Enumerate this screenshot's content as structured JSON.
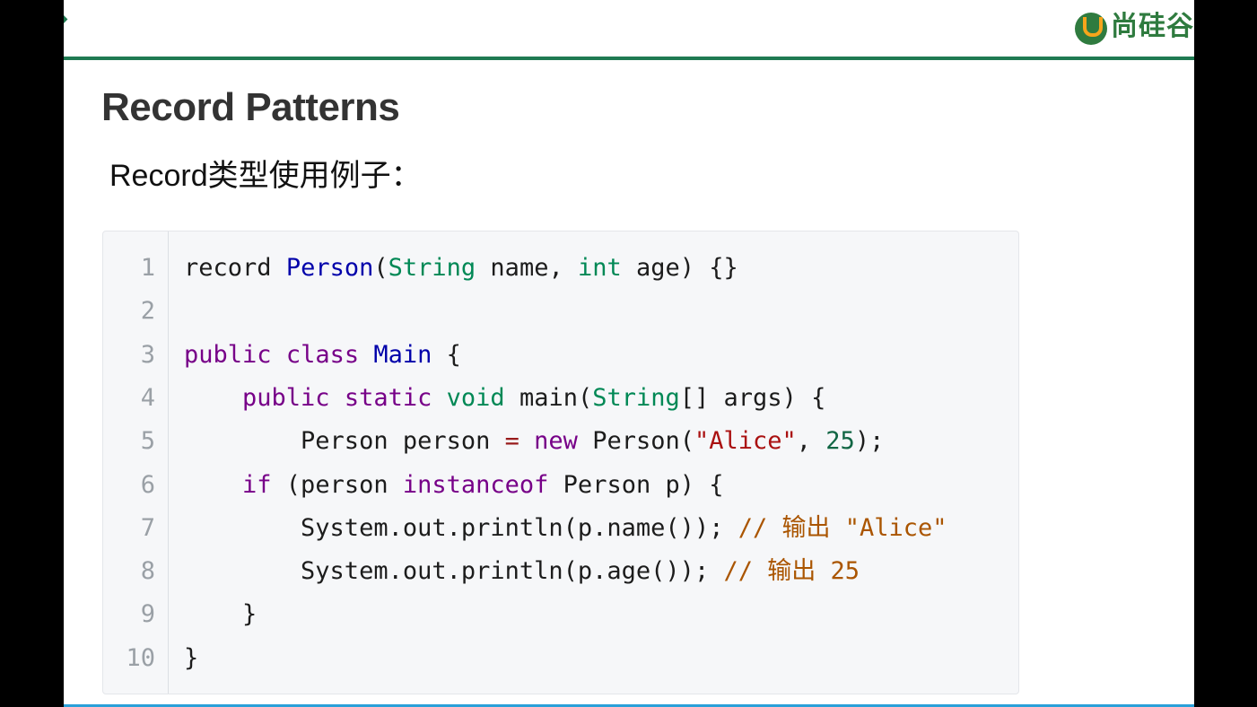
{
  "brand": {
    "name": "尚硅谷",
    "logo_icon": "shangguigu-logo-icon"
  },
  "slide": {
    "title": "Record Patterns",
    "subtitle": "Record类型使用例子："
  },
  "colors": {
    "header_line": "#1f7a52",
    "bottom_line": "#2aa0d8",
    "keyword": "#770088",
    "type": "#008855",
    "definition": "#0000aa",
    "string": "#aa1111",
    "number": "#116644",
    "comment": "#aa5500"
  },
  "code": {
    "line_numbers": [
      "1",
      "2",
      "3",
      "4",
      "5",
      "6",
      "7",
      "8",
      "9",
      "10"
    ],
    "lines": [
      [
        {
          "t": "record",
          "c": ""
        },
        {
          "t": " ",
          "c": ""
        },
        {
          "t": "Person",
          "c": "def"
        },
        {
          "t": "(",
          "c": ""
        },
        {
          "t": "String",
          "c": "type"
        },
        {
          "t": " name, ",
          "c": ""
        },
        {
          "t": "int",
          "c": "type"
        },
        {
          "t": " age) {}",
          "c": ""
        }
      ],
      [],
      [
        {
          "t": "public",
          "c": "kw"
        },
        {
          "t": " ",
          "c": ""
        },
        {
          "t": "class",
          "c": "kw"
        },
        {
          "t": " ",
          "c": ""
        },
        {
          "t": "Main",
          "c": "def"
        },
        {
          "t": " {",
          "c": ""
        }
      ],
      [
        {
          "t": "    ",
          "c": ""
        },
        {
          "t": "public",
          "c": "kw"
        },
        {
          "t": " ",
          "c": ""
        },
        {
          "t": "static",
          "c": "kw"
        },
        {
          "t": " ",
          "c": ""
        },
        {
          "t": "void",
          "c": "type"
        },
        {
          "t": " main(",
          "c": ""
        },
        {
          "t": "String",
          "c": "type"
        },
        {
          "t": "[] args) {",
          "c": ""
        }
      ],
      [
        {
          "t": "        Person person ",
          "c": ""
        },
        {
          "t": "=",
          "c": "op"
        },
        {
          "t": " ",
          "c": ""
        },
        {
          "t": "new",
          "c": "kw"
        },
        {
          "t": " Person(",
          "c": ""
        },
        {
          "t": "\"Alice\"",
          "c": "str"
        },
        {
          "t": ", ",
          "c": ""
        },
        {
          "t": "25",
          "c": "num"
        },
        {
          "t": ");",
          "c": ""
        }
      ],
      [
        {
          "t": "    ",
          "c": ""
        },
        {
          "t": "if",
          "c": "kw"
        },
        {
          "t": " (person ",
          "c": ""
        },
        {
          "t": "instanceof",
          "c": "kw"
        },
        {
          "t": " Person p) {",
          "c": ""
        }
      ],
      [
        {
          "t": "        System.out.println(p.name()); ",
          "c": ""
        },
        {
          "t": "// 输出 \"Alice\"",
          "c": "cmt"
        }
      ],
      [
        {
          "t": "        System.out.println(p.age()); ",
          "c": ""
        },
        {
          "t": "// 输出 25",
          "c": "cmt"
        }
      ],
      [
        {
          "t": "    }",
          "c": ""
        }
      ],
      [
        {
          "t": "}",
          "c": ""
        }
      ]
    ]
  }
}
